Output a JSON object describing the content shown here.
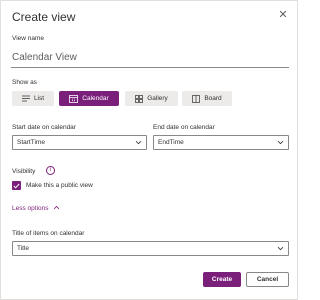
{
  "dialog": {
    "title": "Create view",
    "close_glyph": "✕"
  },
  "view_name": {
    "label": "View name",
    "value": "Calendar View"
  },
  "show_as": {
    "label": "Show as",
    "options": [
      {
        "label": "List",
        "icon": "list-icon",
        "selected": false
      },
      {
        "label": "Calendar",
        "icon": "calendar-icon",
        "selected": true
      },
      {
        "label": "Gallery",
        "icon": "gallery-icon",
        "selected": false
      },
      {
        "label": "Board",
        "icon": "board-icon",
        "selected": false
      }
    ]
  },
  "start_date": {
    "label": "Start date on calendar",
    "value": "StartTime"
  },
  "end_date": {
    "label": "End date on calendar",
    "value": "EndTime"
  },
  "visibility": {
    "label": "Visibility",
    "info_glyph": "i",
    "public_label": "Make this a public view",
    "public_checked": true
  },
  "less_options": {
    "label": "Less options"
  },
  "title_items": {
    "label": "Title of items on calendar",
    "value": "Title"
  },
  "actions": {
    "create_label": "Create",
    "cancel_label": "Cancel"
  },
  "colors": {
    "accent": "#7a1f7a",
    "pill_bg": "#edebe9",
    "border": "#8a8886"
  }
}
